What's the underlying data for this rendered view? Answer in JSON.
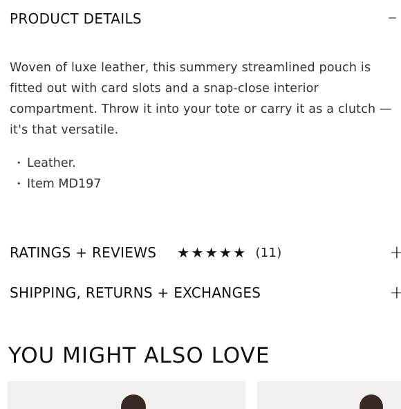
{
  "product_details": {
    "title": "PRODUCT DETAILS",
    "toggle": "–",
    "description": "Woven of luxe leather, this summery streamlined pouch is fitted out with card slots and a snap-close interior compartment. Throw it into your tote or carry it as a clutch —it's that versatile.",
    "bullets": [
      "Leather.",
      "Item MD197"
    ]
  },
  "ratings": {
    "title": "RATINGS + REVIEWS",
    "stars": 5,
    "count": "(11)",
    "toggle": "+"
  },
  "shipping": {
    "title": "SHIPPING, RETURNS + EXCHANGES",
    "toggle": "+"
  },
  "recommendations": {
    "title": "YOU MIGHT ALSO LOVE"
  }
}
